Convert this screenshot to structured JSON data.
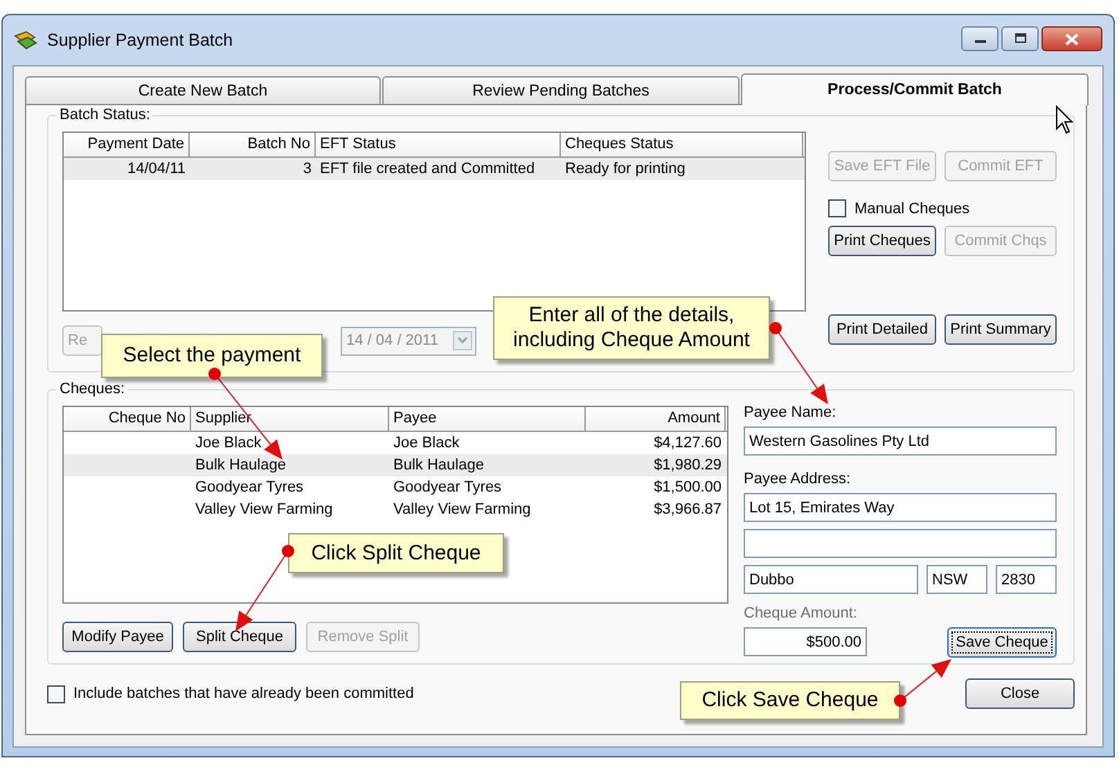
{
  "window": {
    "title": "Supplier Payment Batch"
  },
  "tabs": [
    {
      "label": "Create New Batch",
      "selected": false
    },
    {
      "label": "Review Pending Batches",
      "selected": false
    },
    {
      "label": "Process/Commit Batch",
      "selected": true
    }
  ],
  "batch_status": {
    "label": "Batch Status:",
    "columns": [
      "Payment Date",
      "Batch No",
      "EFT Status",
      "Cheques Status"
    ],
    "rows": [
      {
        "cells": [
          "14/04/11",
          "3",
          "EFT file created and Committed",
          "Ready for printing"
        ],
        "selected": true
      }
    ],
    "reset_button": {
      "label": "Re",
      "disabled": true
    },
    "date_field": {
      "value": "14 / 04 / 2011",
      "disabled": true
    }
  },
  "eft_buttons": [
    {
      "label": "Save EFT File",
      "disabled": true
    },
    {
      "label": "Commit EFT",
      "disabled": true
    }
  ],
  "manual_cheques": {
    "label": "Manual Cheques",
    "checked": false
  },
  "cheque_buttons": [
    {
      "label": "Print Cheques",
      "disabled": false
    },
    {
      "label": "Commit Chqs",
      "disabled": true
    }
  ],
  "print_buttons": [
    {
      "label": "Print Detailed",
      "disabled": false
    },
    {
      "label": "Print Summary",
      "disabled": false
    }
  ],
  "cheques": {
    "label": "Cheques:",
    "columns": [
      "Cheque No",
      "Supplier",
      "Payee",
      "Amount"
    ],
    "rows": [
      {
        "cells": [
          "",
          "Joe Black",
          "Joe Black",
          "$4,127.60"
        ],
        "selected": false
      },
      {
        "cells": [
          "",
          "Bulk Haulage",
          "Bulk Haulage",
          "$1,980.29"
        ],
        "selected": true
      },
      {
        "cells": [
          "",
          "Goodyear Tyres",
          "Goodyear Tyres",
          "$1,500.00"
        ],
        "selected": false
      },
      {
        "cells": [
          "",
          "Valley View Farming",
          "Valley View Farming",
          "$3,966.87"
        ],
        "selected": false
      }
    ],
    "buttons": [
      {
        "label": "Modify Payee",
        "disabled": false
      },
      {
        "label": "Split Cheque",
        "disabled": false
      },
      {
        "label": "Remove Split",
        "disabled": true
      }
    ]
  },
  "payee": {
    "name_label": "Payee Name:",
    "name": "Western Gasolines Pty Ltd",
    "address_label": "Payee Address:",
    "address_1": "Lot 15, Emirates Way",
    "suburb": "Dubbo",
    "state": "NSW",
    "postcode": "2830",
    "amount_label": "Cheque Amount:",
    "amount": "$500.00",
    "save_button": {
      "label": "Save Cheque",
      "disabled": false
    }
  },
  "include_committed": {
    "label": "Include batches that have already been committed",
    "checked": false
  },
  "close_button": {
    "label": "Close"
  },
  "callouts": [
    {
      "text": "Select the payment"
    },
    {
      "text": "Enter all of the details, including Cheque Amount"
    },
    {
      "text": "Click Split Cheque"
    },
    {
      "text": "Click Save Cheque"
    }
  ]
}
